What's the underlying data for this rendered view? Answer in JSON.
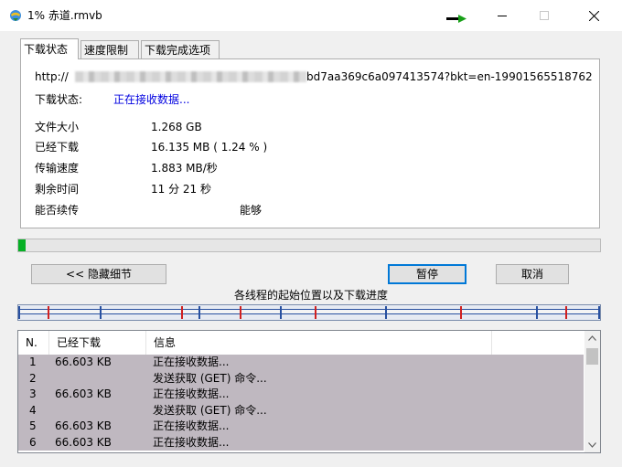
{
  "window": {
    "title": "1% 赤道.rmvb"
  },
  "tabs": [
    {
      "label": "下载状态"
    },
    {
      "label": "速度限制"
    },
    {
      "label": "下载完成选项"
    }
  ],
  "info": {
    "url_prefix": "http://",
    "url_suffix": "bd7aa369c6a097413574?bkt=en-19901565518762",
    "status_label": "下载状态:",
    "status_value": "正在接收数据...",
    "file_size_label": "文件大小",
    "file_size_value": "1.268  GB",
    "downloaded_label": "已经下载",
    "downloaded_value": "16.135  MB  ( 1.24 % )",
    "speed_label": "传输速度",
    "speed_value": "1.883  MB/秒",
    "remaining_label": "剩余时间",
    "remaining_value": "11 分 21 秒",
    "resume_label": "能否续传",
    "resume_value": "能够"
  },
  "progress": {
    "percent": 1.24
  },
  "buttons": {
    "hide_details": "<< 隐藏细节",
    "pause": "暂停",
    "cancel": "取消"
  },
  "threads": {
    "title": "各线程的起始位置以及下载进度",
    "marker_fractions": [
      0.0,
      0.05,
      0.14,
      0.28,
      0.31,
      0.38,
      0.45,
      0.51,
      0.63,
      0.76,
      0.89,
      0.94,
      1.0
    ],
    "color_main": "#2850a0",
    "color_marker": "#d02020"
  },
  "list": {
    "headers": [
      "N.",
      "已经下载",
      "信息"
    ],
    "rows": [
      {
        "n": "1",
        "downloaded": "66.603 KB",
        "info": "正在接收数据..."
      },
      {
        "n": "2",
        "downloaded": "",
        "info": "发送获取 (GET) 命令..."
      },
      {
        "n": "3",
        "downloaded": "66.603 KB",
        "info": "正在接收数据..."
      },
      {
        "n": "4",
        "downloaded": "",
        "info": "发送获取 (GET) 命令..."
      },
      {
        "n": "5",
        "downloaded": "66.603 KB",
        "info": "正在接收数据..."
      },
      {
        "n": "6",
        "downloaded": "66.603 KB",
        "info": "正在接收数据..."
      }
    ]
  },
  "colors": {
    "progress_fill": "#06b025",
    "row_background": "#bfb8c0",
    "status_text": "#0000e0",
    "accent": "#0078d7"
  },
  "icons": {
    "app": "ie-globe-icon",
    "arrow": "green-arrow-icon",
    "minimize": "minimize-icon",
    "maximize": "maximize-icon",
    "close": "close-icon",
    "scroll_up": "chevron-up-icon",
    "scroll_down": "chevron-down-icon"
  }
}
